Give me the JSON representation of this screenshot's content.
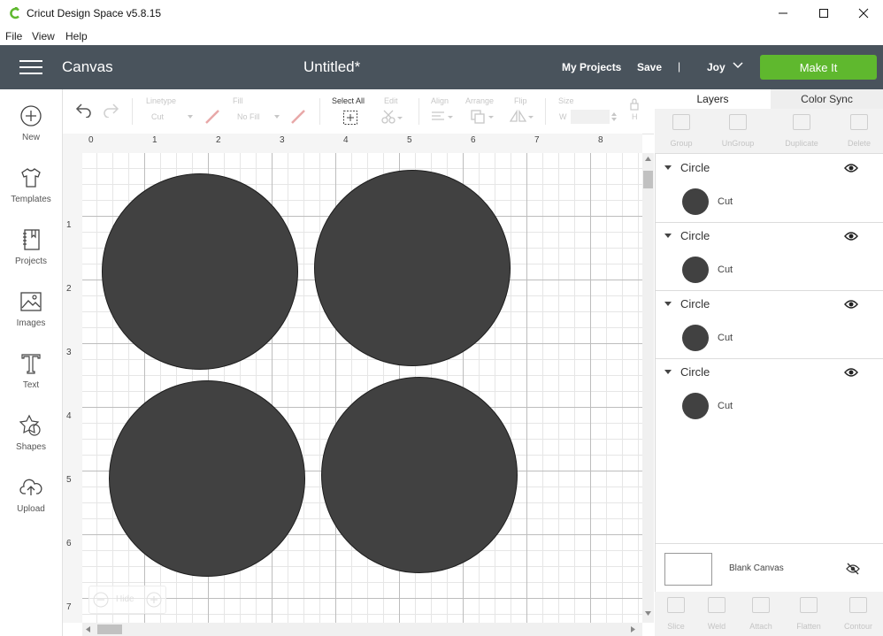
{
  "window": {
    "title": "Cricut Design Space  v5.8.15",
    "menu": [
      "File",
      "View",
      "Help"
    ]
  },
  "header": {
    "section": "Canvas",
    "document_title": "Untitled*",
    "my_projects": "My Projects",
    "save": "Save",
    "separator": "|",
    "user": "Joy",
    "make_it": "Make It",
    "accent_color": "#5fb82e",
    "bg_color": "#49535c"
  },
  "sidebar": {
    "items": [
      {
        "label": "New",
        "icon": "plus-circle-icon"
      },
      {
        "label": "Templates",
        "icon": "tshirt-icon"
      },
      {
        "label": "Projects",
        "icon": "notebook-icon"
      },
      {
        "label": "Images",
        "icon": "image-icon"
      },
      {
        "label": "Text",
        "icon": "text-T-icon"
      },
      {
        "label": "Shapes",
        "icon": "shapes-icon"
      },
      {
        "label": "Upload",
        "icon": "cloud-upload-icon"
      }
    ]
  },
  "toolbar": {
    "linetype_label": "Linetype",
    "linetype_value": "Cut",
    "fill_label": "Fill",
    "fill_value": "No Fill",
    "select_all": "Select All",
    "edit": "Edit",
    "align": "Align",
    "arrange": "Arrange",
    "flip": "Flip",
    "size": "Size",
    "size_w": "W",
    "size_h": "H"
  },
  "rulers": {
    "top": [
      "0",
      "1",
      "2",
      "3",
      "4",
      "5",
      "6",
      "7",
      "8"
    ],
    "left": [
      "1",
      "2",
      "3",
      "4",
      "5",
      "6",
      "7"
    ]
  },
  "canvas": {
    "zoom_label": "Hide",
    "shape_color": "#414141"
  },
  "panel": {
    "tabs": [
      "Layers",
      "Color Sync"
    ],
    "tools": [
      "Group",
      "UnGroup",
      "Duplicate",
      "Delete"
    ],
    "layers": [
      {
        "name": "Circle",
        "operation": "Cut"
      },
      {
        "name": "Circle",
        "operation": "Cut"
      },
      {
        "name": "Circle",
        "operation": "Cut"
      },
      {
        "name": "Circle",
        "operation": "Cut"
      }
    ],
    "blank_canvas": "Blank Canvas",
    "bottom_tools": [
      "Slice",
      "Weld",
      "Attach",
      "Flatten",
      "Contour"
    ]
  }
}
